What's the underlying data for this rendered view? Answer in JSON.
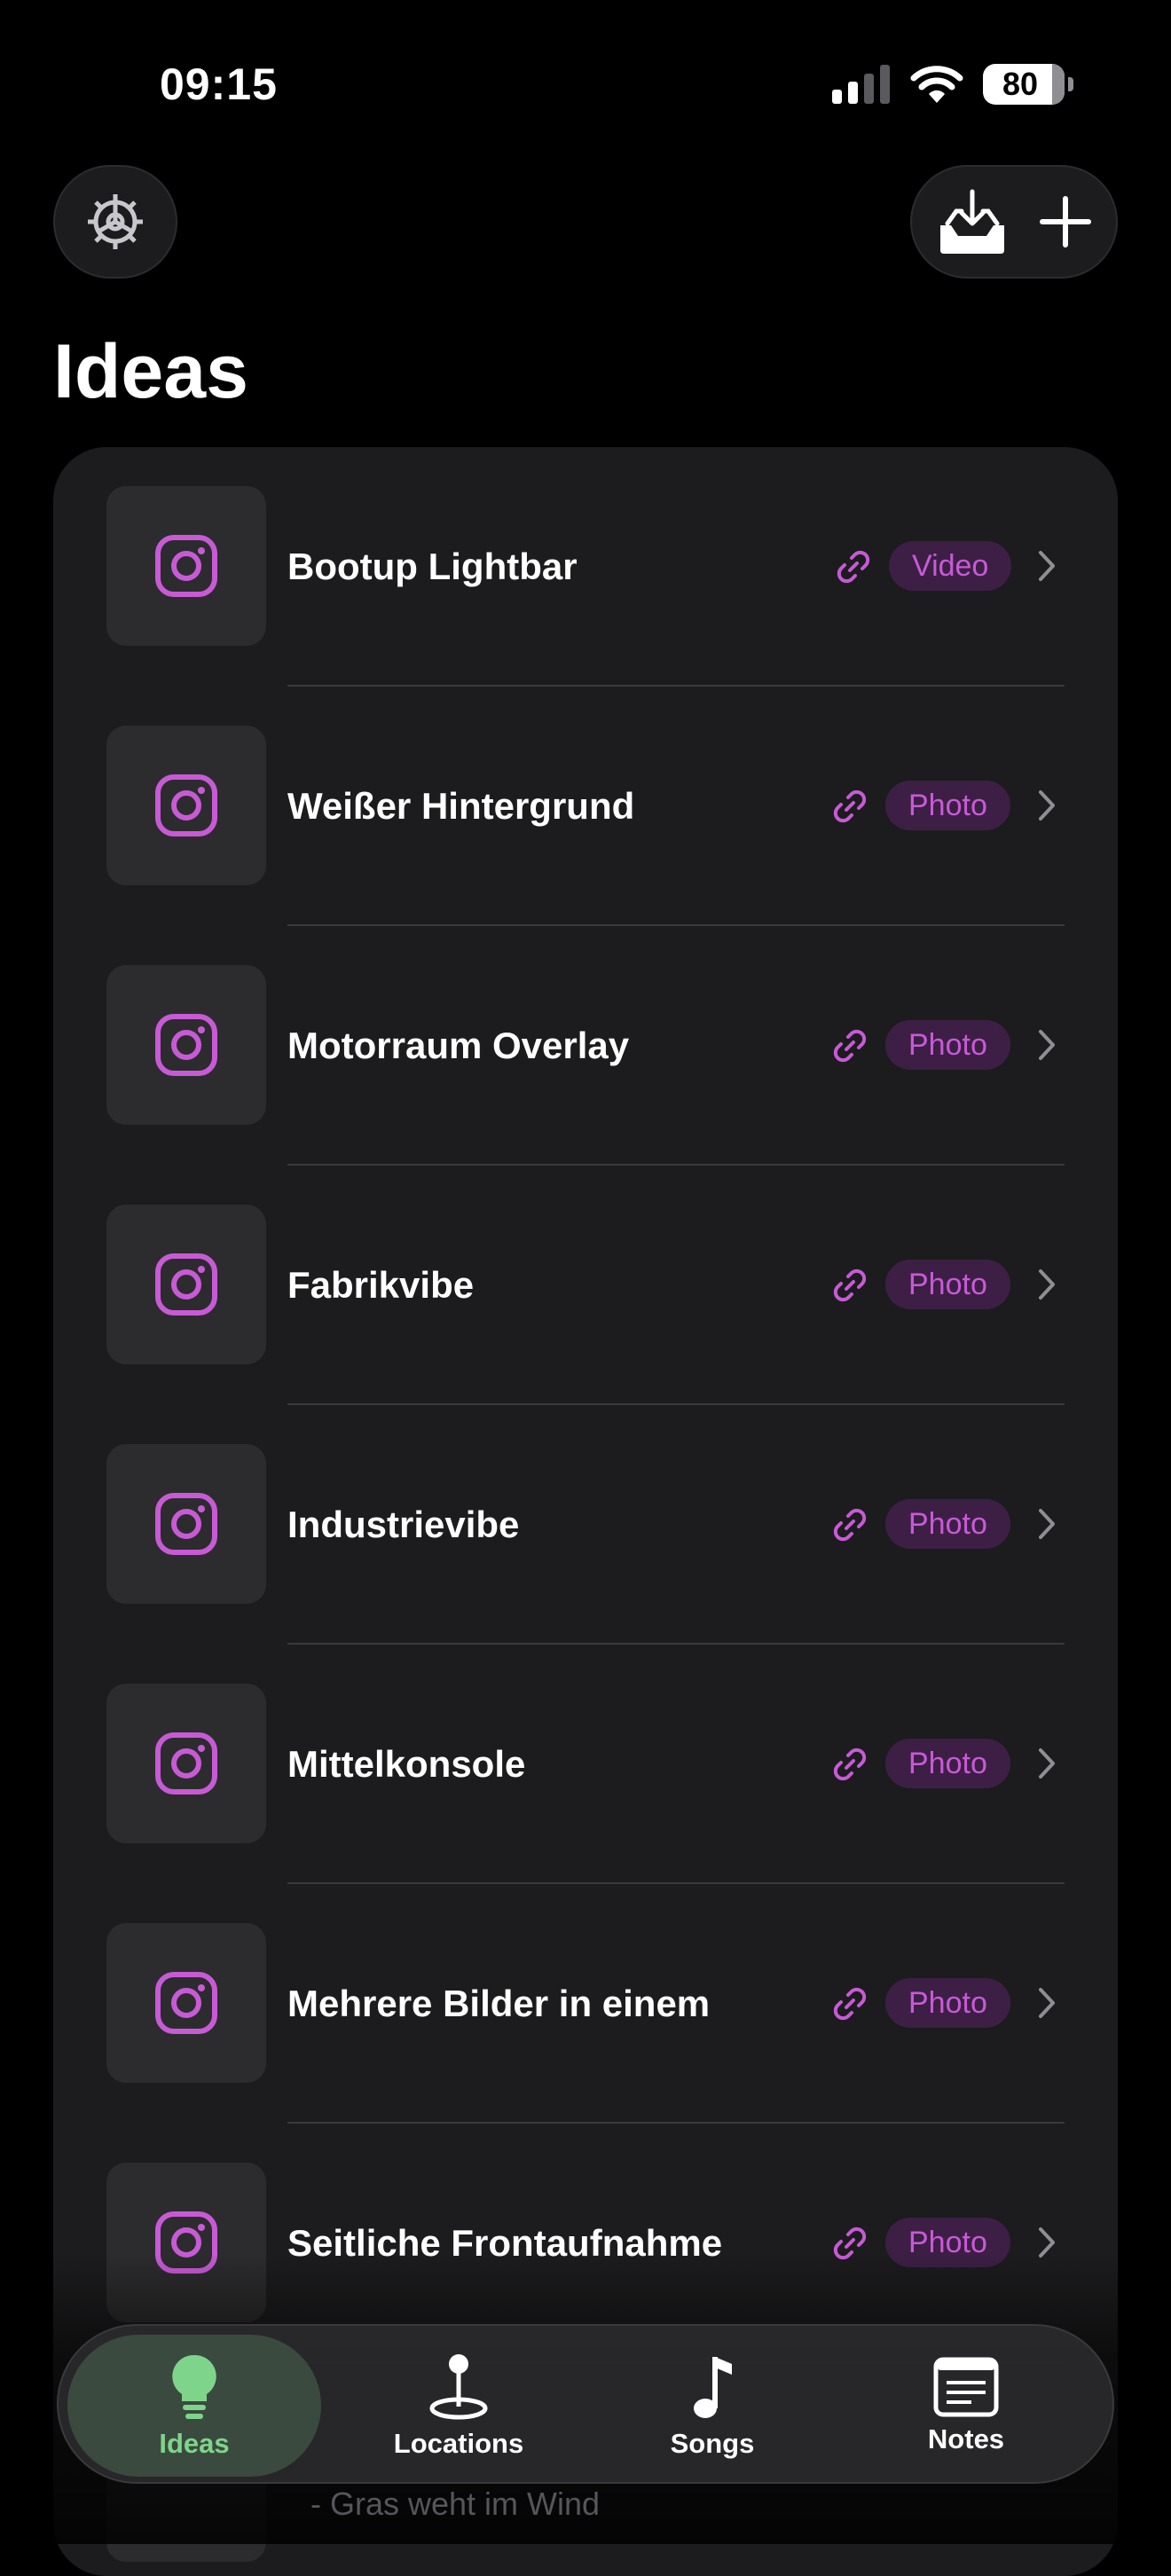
{
  "status_bar": {
    "time": "09:15",
    "battery": "80"
  },
  "header": {
    "title": "Ideas"
  },
  "items": [
    {
      "title": "Bootup Lightbar",
      "type": "Video"
    },
    {
      "title": "Weißer Hintergrund",
      "type": "Photo"
    },
    {
      "title": "Motorraum Overlay",
      "type": "Photo"
    },
    {
      "title": "Fabrikvibe",
      "type": "Photo"
    },
    {
      "title": "Industrievibe",
      "type": "Photo"
    },
    {
      "title": "Mittelkonsole",
      "type": "Photo"
    },
    {
      "title": "Mehrere Bilder in einem",
      "type": "Photo"
    },
    {
      "title": "Seitliche Frontaufnahme",
      "type": "Photo"
    }
  ],
  "partial_item": {
    "subtitle": "- Gras weht im Wind"
  },
  "tabs": [
    {
      "label": "Ideas",
      "icon": "lightbulb-icon",
      "active": true
    },
    {
      "label": "Locations",
      "icon": "location-pin-icon",
      "active": false
    },
    {
      "label": "Songs",
      "icon": "music-note-icon",
      "active": false
    },
    {
      "label": "Notes",
      "icon": "notes-icon",
      "active": false
    }
  ],
  "colors": {
    "accent": "#c85ad6",
    "badge_bg": "#3d1f45",
    "active_tab": "#7fd48c",
    "card_bg": "#1c1c1e"
  }
}
